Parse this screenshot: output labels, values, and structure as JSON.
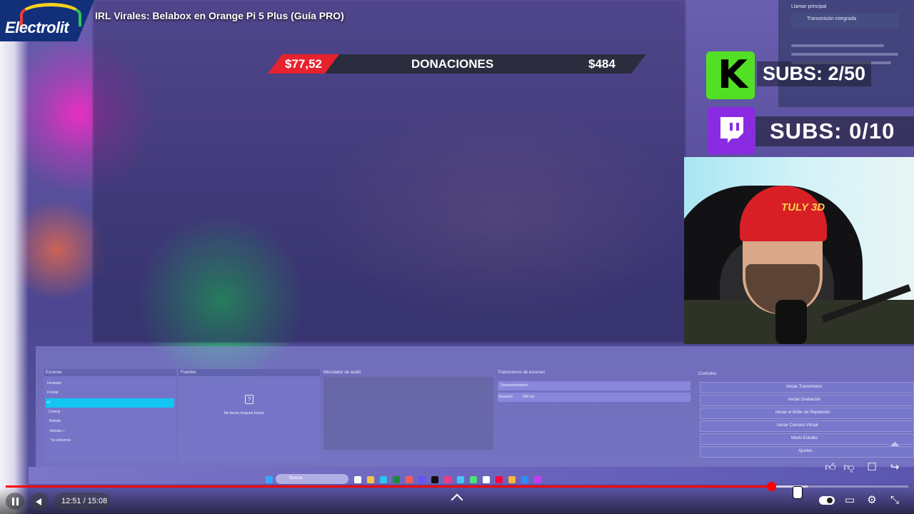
{
  "video": {
    "title": "IRL Virales: Belabox en Orange Pi 5 Plus (Guía PRO)",
    "time": "12:51 / 15:08",
    "progress_fraction": 0.848
  },
  "sponsor": {
    "text": "Electrolit"
  },
  "overlay": {
    "donations_left": "$77,52",
    "donations_title": "DONACIONES",
    "donations_right": "$484",
    "kick_subs": "SUBS: 2/50",
    "twitch_subs": "SUBS: 0/10"
  },
  "cam": {
    "cap_text": "TULY 3D"
  },
  "background_ui": {
    "top_right_title": "Llamar principal",
    "top_right_button": "Transmisión integrada",
    "scenes_header": "Escenas",
    "sources_header": "Fuentes",
    "audio_header": "Mezclador de audio",
    "transitions_header": "Transiciones de escenas",
    "controls_header": "Controles",
    "scenes": [
      "Iniciando",
      "Frontal",
      "el",
      "Central",
      "Retrato",
      "Retrato +",
      "Ya volvemos"
    ],
    "sources_empty": "No tienes ninguna fuente.",
    "transition_select": "Desvanecimiento",
    "duration_label": "Duración",
    "duration_value": "300 ms",
    "controls": [
      "Iniciar Transmisión",
      "Iniciar Grabación",
      "Iniciar el Búfer de Repetición",
      "Iniciar Cámara Virtual",
      "Modo Estudio",
      "Ajustes"
    ],
    "taskbar_search": "Buscar"
  },
  "colors": {
    "accent_red": "#ff0000",
    "kick_green": "#52e024",
    "twitch_purple": "#8a2be2",
    "donations_red": "#e5222e",
    "scene_selected": "#12c5f2"
  },
  "icons": [
    "pause-icon",
    "volume-icon",
    "chevron-up-icon",
    "toggle-icon",
    "captions-icon",
    "settings-icon",
    "exit-fullscreen-icon",
    "like-icon",
    "dislike-icon",
    "comment-icon",
    "share-icon"
  ]
}
